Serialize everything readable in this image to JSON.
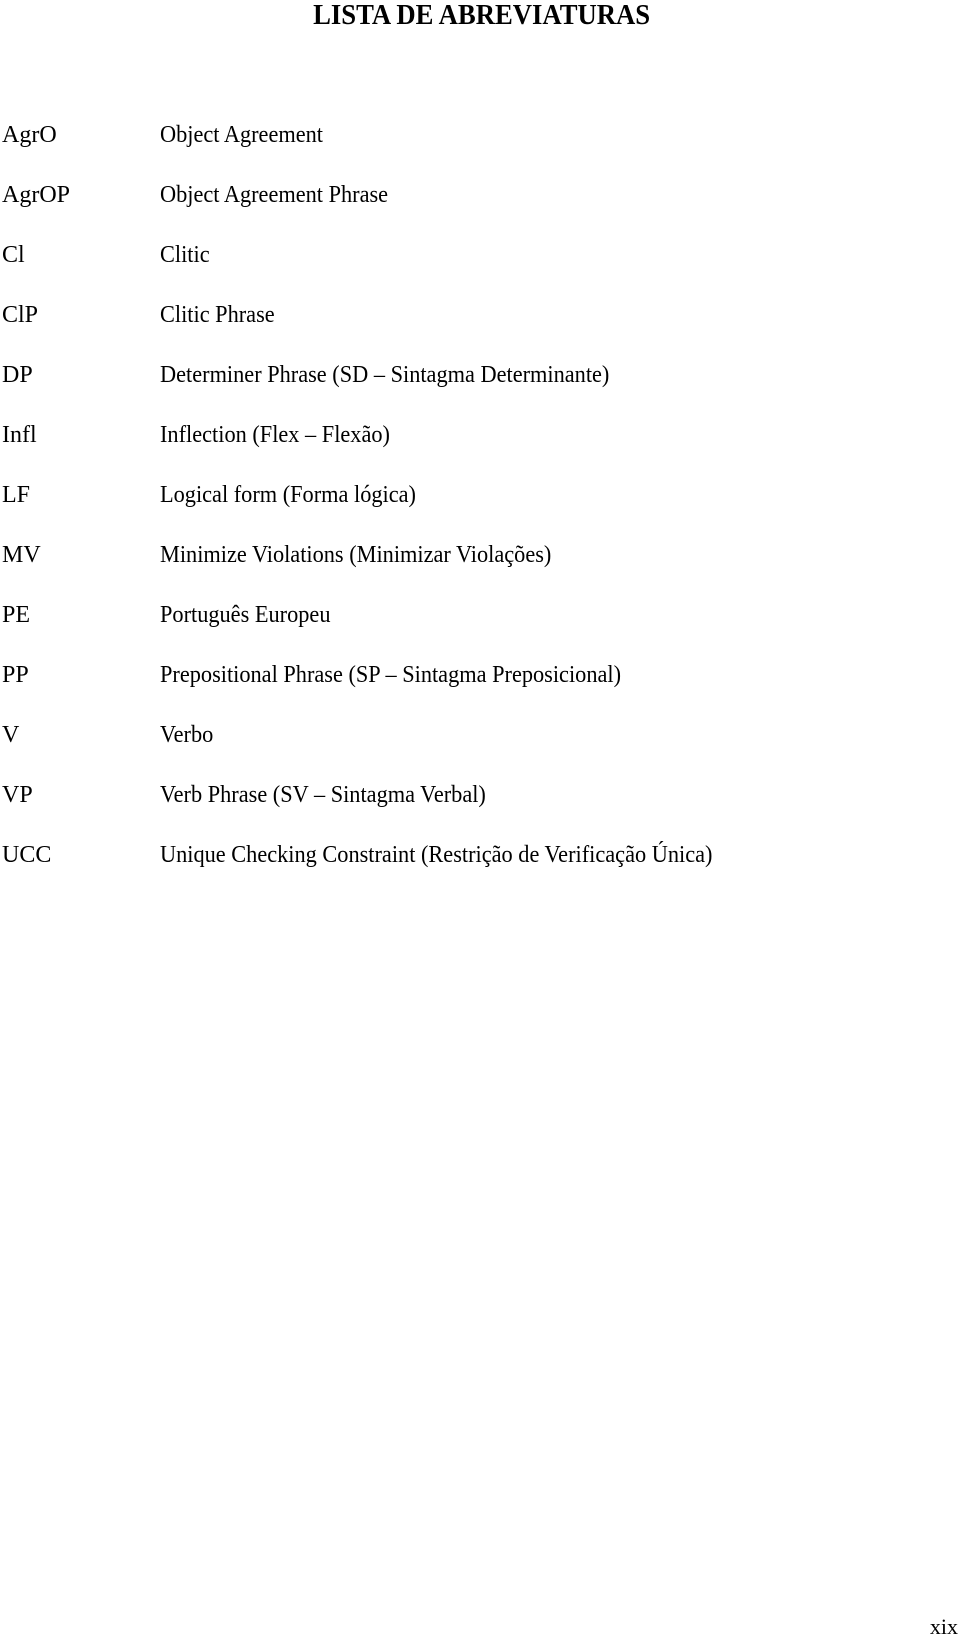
{
  "title": "LISTA DE ABREVIATURAS",
  "entries": [
    {
      "abbr": "AgrO",
      "desc": "Object Agreement"
    },
    {
      "abbr": "AgrOP",
      "desc": "Object Agreement Phrase"
    },
    {
      "abbr": "Cl",
      "desc": "Clitic"
    },
    {
      "abbr": "ClP",
      "desc": "Clitic Phrase"
    },
    {
      "abbr": "DP",
      "desc": "Determiner Phrase (SD – Sintagma Determinante)"
    },
    {
      "abbr": "Infl",
      "desc": "Inflection (Flex – Flexão)"
    },
    {
      "abbr": "LF",
      "desc": "Logical form (Forma lógica)"
    },
    {
      "abbr": "MV",
      "desc": "Minimize Violations (Minimizar Violações)"
    },
    {
      "abbr": "PE",
      "desc": "Português Europeu"
    },
    {
      "abbr": "PP",
      "desc": "Prepositional Phrase (SP – Sintagma Preposicional)"
    },
    {
      "abbr": "V",
      "desc": "Verbo"
    },
    {
      "abbr": "VP",
      "desc": "Verb Phrase (SV – Sintagma Verbal)"
    },
    {
      "abbr": "UCC",
      "desc": "Unique Checking Constraint (Restrição de Verificação Única)"
    }
  ],
  "page_number": "xix"
}
